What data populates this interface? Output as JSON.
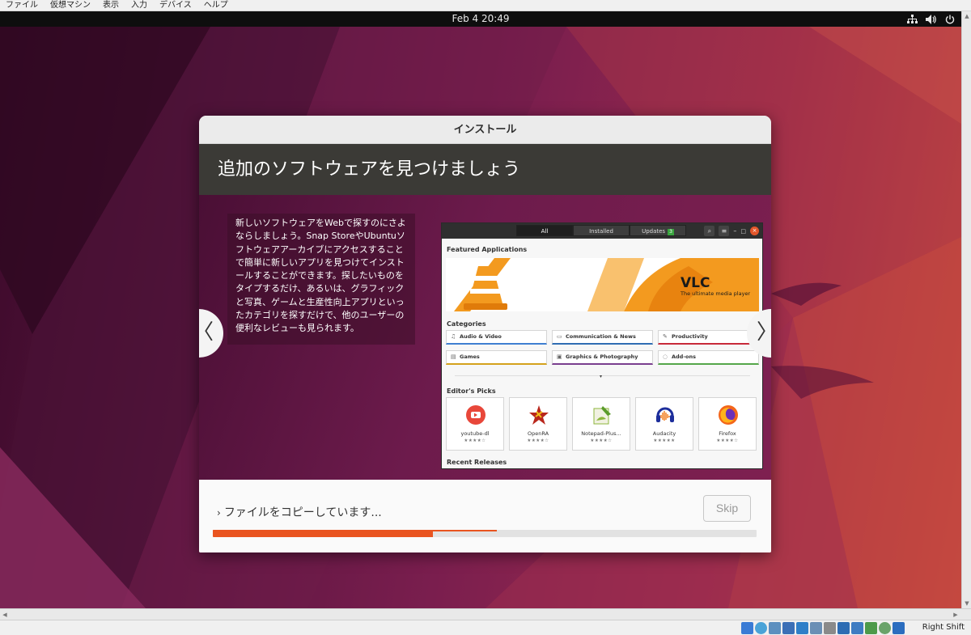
{
  "host_menu": [
    "ファイル",
    "仮想マシン",
    "表示",
    "入力",
    "デバイス",
    "ヘルプ"
  ],
  "topbar": {
    "clock": "Feb 4  20:49"
  },
  "installer": {
    "title": "インストール",
    "heading": "追加のソフトウェアを見つけましょう",
    "slide_text": "新しいソフトウェアをWebで探すのにさよならしましょう。Snap StoreやUbuntuソフトウェアアーカイブにアクセスすることで簡単に新しいアプリを見つけてインストールすることができます。探したいものをタイプするだけ、あるいは、グラフィックと写真、ゲームと生産性向上アプリといったカテゴリを探すだけで、他のユーザーの便利なレビューも見られます。",
    "prev_glyph": "〈",
    "next_glyph": "〉",
    "status": "ファイルをコピーしています...",
    "status_chevron": "›",
    "skip_label": "Skip",
    "progress_main": 0.405,
    "progress_secondary": 0.523
  },
  "software_center": {
    "tabs": [
      "All",
      "Installed",
      "Updates"
    ],
    "updates_badge": "3",
    "featured_title": "Featured Applications",
    "vlc_title": "VLC",
    "vlc_subtitle": "The ultimate media player",
    "categories_title": "Categories",
    "categories": [
      {
        "label": "Audio & Video",
        "color": "#3f7fd1",
        "icon": "♫"
      },
      {
        "label": "Communication & News",
        "color": "#2f6db3",
        "icon": "▭"
      },
      {
        "label": "Productivity",
        "color": "#c7293a",
        "icon": "✎"
      },
      {
        "label": "Games",
        "color": "#d4a21c",
        "icon": "▤"
      },
      {
        "label": "Graphics & Photography",
        "color": "#7a3f8f",
        "icon": "▣"
      },
      {
        "label": "Add-ons",
        "color": "#55a64a",
        "icon": "◌"
      }
    ],
    "more_glyph": "▾",
    "editors_picks_title": "Editor's Picks",
    "picks": [
      {
        "name": "youtube-dl",
        "stars": "★★★★☆"
      },
      {
        "name": "OpenRA",
        "stars": "★★★★☆"
      },
      {
        "name": "Notepad-Plus...",
        "stars": "★★★★☆"
      },
      {
        "name": "Audacity",
        "stars": "★★★★★"
      },
      {
        "name": "Firefox",
        "stars": "★★★★☆"
      }
    ],
    "recent_title": "Recent Releases"
  },
  "statusbar": {
    "host_key": "Right Shift"
  },
  "colors": {
    "accent": "#e95420",
    "header_bg": "#3b3a36"
  }
}
